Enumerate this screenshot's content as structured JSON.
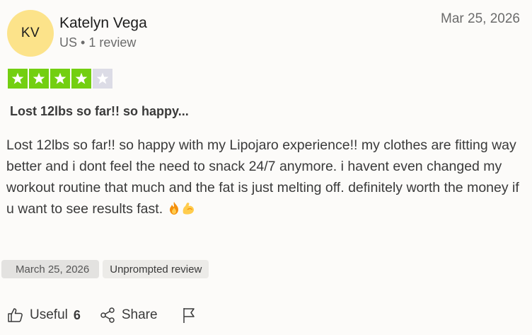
{
  "reviewer": {
    "initials": "KV",
    "name": "Katelyn Vega",
    "country": "US",
    "separator": "•",
    "review_count": "1 review",
    "avatar_color": "#fce38a"
  },
  "review": {
    "date_header": "Mar 25, 2026",
    "rating": 4,
    "rating_max": 5,
    "star_color": "#73cf11",
    "title": "Lost 12lbs so far!! so happy...",
    "body": "Lost 12lbs so far!! so happy with my Lipojaro experience!! my clothes are fitting way better and i dont feel the need to snack 24/7 anymore. i havent even changed my workout routine that much and the fat is just melting off. definitely worth the money if u want to see results fast.",
    "emojis": [
      "fire-emoji",
      "flexed-biceps-emoji"
    ]
  },
  "tags": {
    "date": "March 25, 2026",
    "unprompted": "Unprompted review"
  },
  "actions": {
    "useful_label": "Useful",
    "useful_count": "6",
    "share_label": "Share"
  }
}
